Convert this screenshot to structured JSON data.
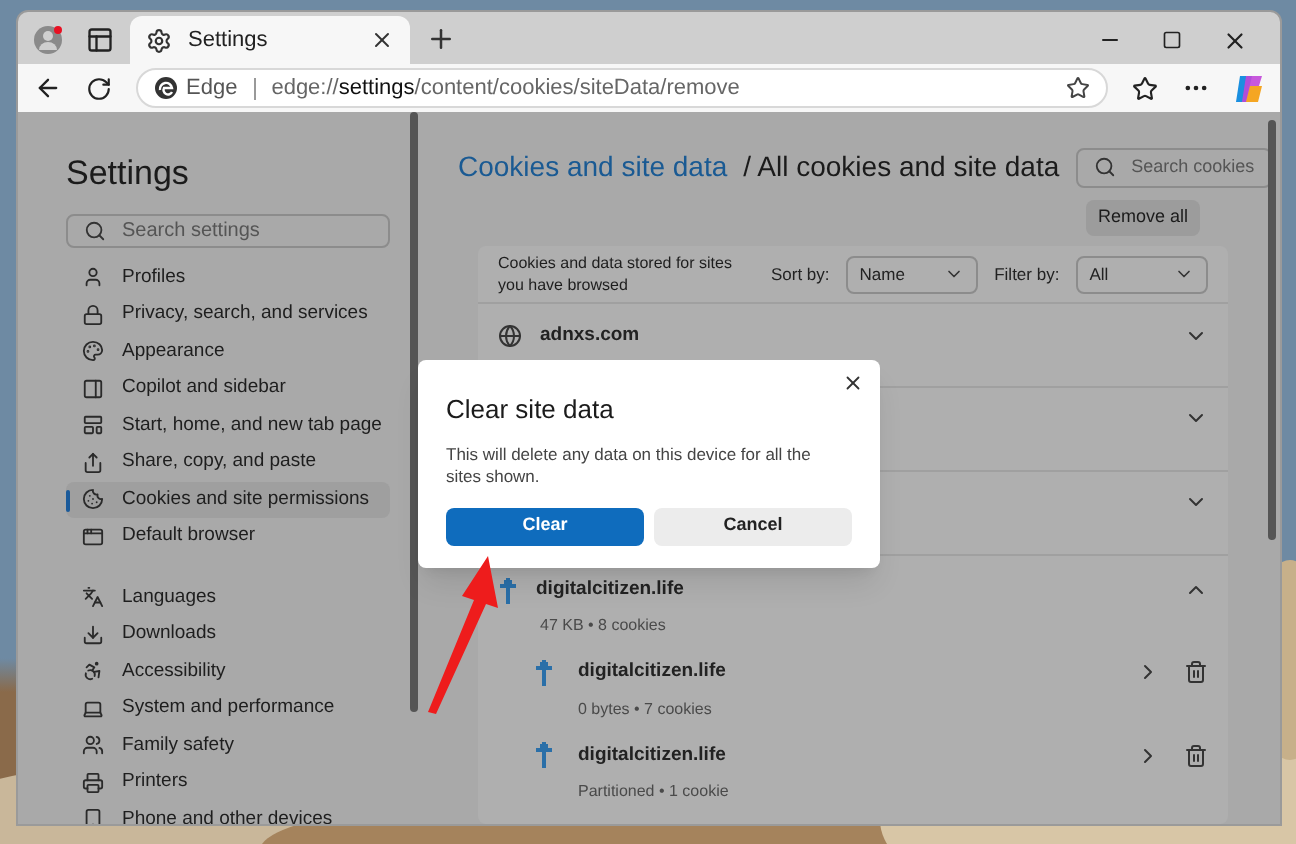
{
  "browser": {
    "tab": {
      "title": "Settings"
    },
    "address": {
      "label": "Edge",
      "url": "edge://**settings**/content/cookies/siteData/remove"
    }
  },
  "sidebar": {
    "title": "Settings",
    "search": {
      "placeholder": "Search settings"
    },
    "items": [
      {
        "label": "Profiles",
        "selected": false
      },
      {
        "label": "Privacy, search, and services",
        "selected": false
      },
      {
        "label": "Appearance",
        "selected": false
      },
      {
        "label": "Copilot and sidebar",
        "selected": false
      },
      {
        "label": "Start, home, and new tab page",
        "selected": false
      },
      {
        "label": "Share, copy, and paste",
        "selected": false
      },
      {
        "label": "Cookies and site permissions",
        "selected": true
      },
      {
        "label": "Default browser",
        "selected": false
      },
      {
        "label": "Languages",
        "selected": false
      },
      {
        "label": "Downloads",
        "selected": false
      },
      {
        "label": "Accessibility",
        "selected": false
      },
      {
        "label": "System and performance",
        "selected": false
      },
      {
        "label": "Family safety",
        "selected": false
      },
      {
        "label": "Printers",
        "selected": false
      },
      {
        "label": "Phone and other devices",
        "selected": false
      }
    ]
  },
  "main": {
    "breadcrumb_link": "Cookies and site data",
    "breadcrumb_current": "/ All cookies and site data",
    "search": {
      "placeholder": "Search cookies"
    },
    "remove_all": "Remove all",
    "list_caption": "Cookies and data stored for sites you have browsed",
    "sort_label": "Sort by:",
    "sort_value": "Name",
    "filter_label": "Filter by:",
    "filter_value": "All",
    "sites": [
      {
        "name": "adnxs.com",
        "expanded": false,
        "kind": "globe"
      },
      {
        "expanded": false
      },
      {
        "expanded": false
      },
      {
        "name": "digitalcitizen.life",
        "detail": "47 KB • 8 cookies",
        "expanded": true,
        "kind": "favicon",
        "children": [
          {
            "name": "digitalcitizen.life",
            "detail": "0 bytes • 7 cookies"
          },
          {
            "name": "digitalcitizen.life",
            "detail": "Partitioned • 1 cookie"
          }
        ]
      }
    ]
  },
  "dialog": {
    "title": "Clear site data",
    "message": "This will delete any data on this device for all the sites shown.",
    "buttons": [
      {
        "label": "Clear",
        "kind": "primary"
      },
      {
        "label": "Cancel",
        "kind": "secondary"
      }
    ]
  }
}
